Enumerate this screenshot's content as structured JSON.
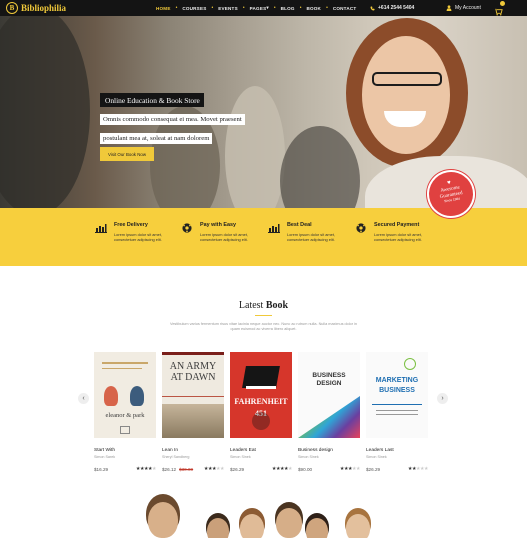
{
  "brand": {
    "name": "Bibliophilia",
    "logo_letter": "B"
  },
  "nav": {
    "items": [
      {
        "label": "HOME",
        "active": true
      },
      {
        "label": "COURSES",
        "active": false
      },
      {
        "label": "EVENTS",
        "active": false
      },
      {
        "label": "PAGES",
        "active": false,
        "caret": "▾"
      },
      {
        "label": "BLOG",
        "active": false
      },
      {
        "label": "BOOK",
        "active": false
      },
      {
        "label": "CONTACT",
        "active": false
      }
    ],
    "phone": "+614 2544 5404",
    "account_label": "My Account",
    "icons": {
      "phone": "phone-icon",
      "account": "user-icon",
      "cart": "cart-icon"
    }
  },
  "hero": {
    "title": "Online Education &  Book Store",
    "subtitle_line1": "Omnis commodo consequat ei mea. Movet praesent",
    "subtitle_line2": "postulant mea at, soleat at nam dolorem",
    "button_label": "Visit Our Book Now",
    "badge": {
      "line1": "Awesome",
      "line2": "Guaranteed",
      "line3": "Since 1984"
    }
  },
  "features": [
    {
      "icon": "chart-icon",
      "title": "Free Delivery",
      "text1": "Lorem ipsum dolor sit amet,",
      "text2": "consectetuer adipiscing elit."
    },
    {
      "icon": "ball-icon",
      "title": "Pay with Easy",
      "text1": "Lorem ipsum dolor sit amet,",
      "text2": "consectetuer adipiscing elit."
    },
    {
      "icon": "chart-icon",
      "title": "Best Deal",
      "text1": "Lorem ipsum dolor sit amet,",
      "text2": "consectetuer adipiscing elit."
    },
    {
      "icon": "ball-icon",
      "title": "Secured Payment",
      "text1": "Lorem ipsum dolor sit amet,",
      "text2": "consectetuer adipiscing elit."
    }
  ],
  "latest": {
    "title_light": "Latest ",
    "title_bold": "Book",
    "desc1": "Vestibulum varius fermentum risus vitae lacinia neque auctor nec. Nunc ac rutrum nulla. Nulla maximus dolor in",
    "desc2": "quam euismod ac viverra libero aliquet.",
    "prev": "‹",
    "next": "›"
  },
  "books": [
    {
      "title": "Start With",
      "author": "Simon Sarek",
      "price": "$16.29",
      "old_price": "",
      "rating": 4,
      "cover_text": "eleanor & park"
    },
    {
      "title": "Lean In",
      "author": "Sheryl Sandberg",
      "price": "$26.12",
      "old_price": "$30.00",
      "rating": 3,
      "cover_text": "AN ARMY AT DAWN"
    },
    {
      "title": "Leaders Eat",
      "author": "Simon Sinek",
      "price": "$26.29",
      "old_price": "",
      "rating": 4,
      "cover_text": "FAHRENHEIT 451"
    },
    {
      "title": "Business design",
      "author": "Simon Sinek",
      "price": "$90.00",
      "old_price": "",
      "rating": 3,
      "cover_text": "BUSINESS DESIGN"
    },
    {
      "title": "Leaders Last",
      "author": "Simon Sinek",
      "price": "$26.29",
      "old_price": "",
      "rating": 2,
      "cover_text": "MARKETING BUSINESS"
    }
  ],
  "colors": {
    "accent": "#f0c93a",
    "dark": "#141414",
    "feature_band": "#f7cf3d",
    "badge": "#e04140"
  }
}
